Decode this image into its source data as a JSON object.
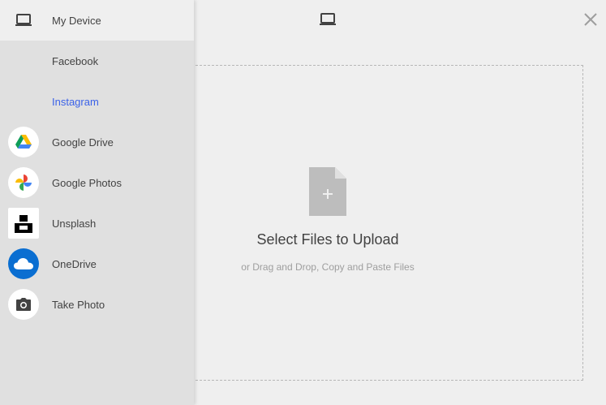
{
  "sidebar": {
    "items": [
      {
        "label": "My Device",
        "icon": "laptop-icon"
      },
      {
        "label": "Facebook",
        "icon": ""
      },
      {
        "label": "Instagram",
        "icon": ""
      },
      {
        "label": "Google Drive",
        "icon": "google-drive-icon"
      },
      {
        "label": "Google Photos",
        "icon": "google-photos-icon"
      },
      {
        "label": "Unsplash",
        "icon": "unsplash-icon"
      },
      {
        "label": "OneDrive",
        "icon": "onedrive-icon"
      },
      {
        "label": "Take Photo",
        "icon": "camera-icon"
      }
    ]
  },
  "main": {
    "title": "Select Files to Upload",
    "subtitle": "or Drag and Drop, Copy and Paste Files"
  },
  "colors": {
    "link": "#3b62e8",
    "sidebar_bg": "#e0e0e0",
    "main_bg": "#efefef",
    "onedrive_blue": "#0a6ed1"
  }
}
